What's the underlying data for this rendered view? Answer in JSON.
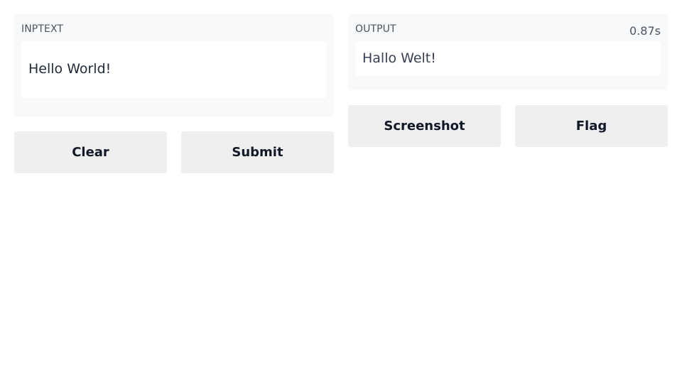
{
  "input": {
    "label": "INPTEXT",
    "value": "Hello World!"
  },
  "output": {
    "label": "OUTPUT",
    "timer": "0.87s",
    "value": "Hallo Welt!"
  },
  "buttons": {
    "clear": "Clear",
    "submit": "Submit",
    "screenshot": "Screenshot",
    "flag": "Flag"
  }
}
